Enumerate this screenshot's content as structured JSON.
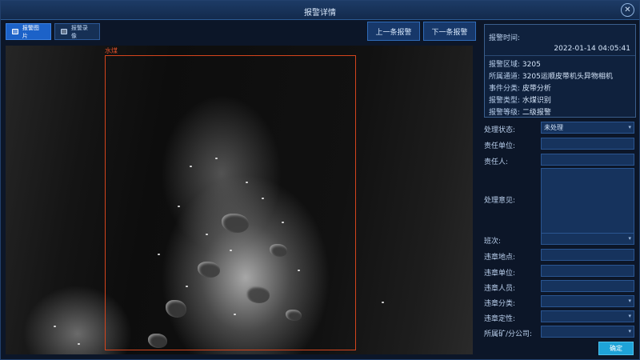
{
  "window": {
    "title": "报警详情"
  },
  "tabs": [
    {
      "label": "报警图片",
      "active": true
    },
    {
      "label": "报警录像",
      "active": false
    }
  ],
  "nav": {
    "prev": "上一条报警",
    "next": "下一条报警"
  },
  "detection": {
    "label": "水煤"
  },
  "info": {
    "time_label": "报警时间:",
    "time_value": "2022-01-14 04:05:41",
    "rows": [
      {
        "label": "报警区域:",
        "value": "3205"
      },
      {
        "label": "所属通道:",
        "value": "3205运顺皮带机头异物相机"
      },
      {
        "label": "事件分类:",
        "value": "皮带分析"
      },
      {
        "label": "报警类型:",
        "value": "水煤识别"
      },
      {
        "label": "报警等级:",
        "value": "二级报警"
      }
    ]
  },
  "form": {
    "status_label": "处理状态:",
    "status_value": "未处理",
    "unit_label": "责任单位:",
    "person_label": "责任人:",
    "opinion_label": "处理意见:",
    "shift_label": "班次:",
    "violation_location_label": "违章地点:",
    "violation_unit_label": "违章单位:",
    "violator_label": "违章人员:",
    "violation_category_label": "违章分类:",
    "violation_nature_label": "违章定性:",
    "mine_label": "所属矿/分公司:",
    "confirm": "确定"
  },
  "colors": {
    "accent": "#1c62c8",
    "detection_box": "#d4441c",
    "confirm": "#1ea3d8"
  }
}
